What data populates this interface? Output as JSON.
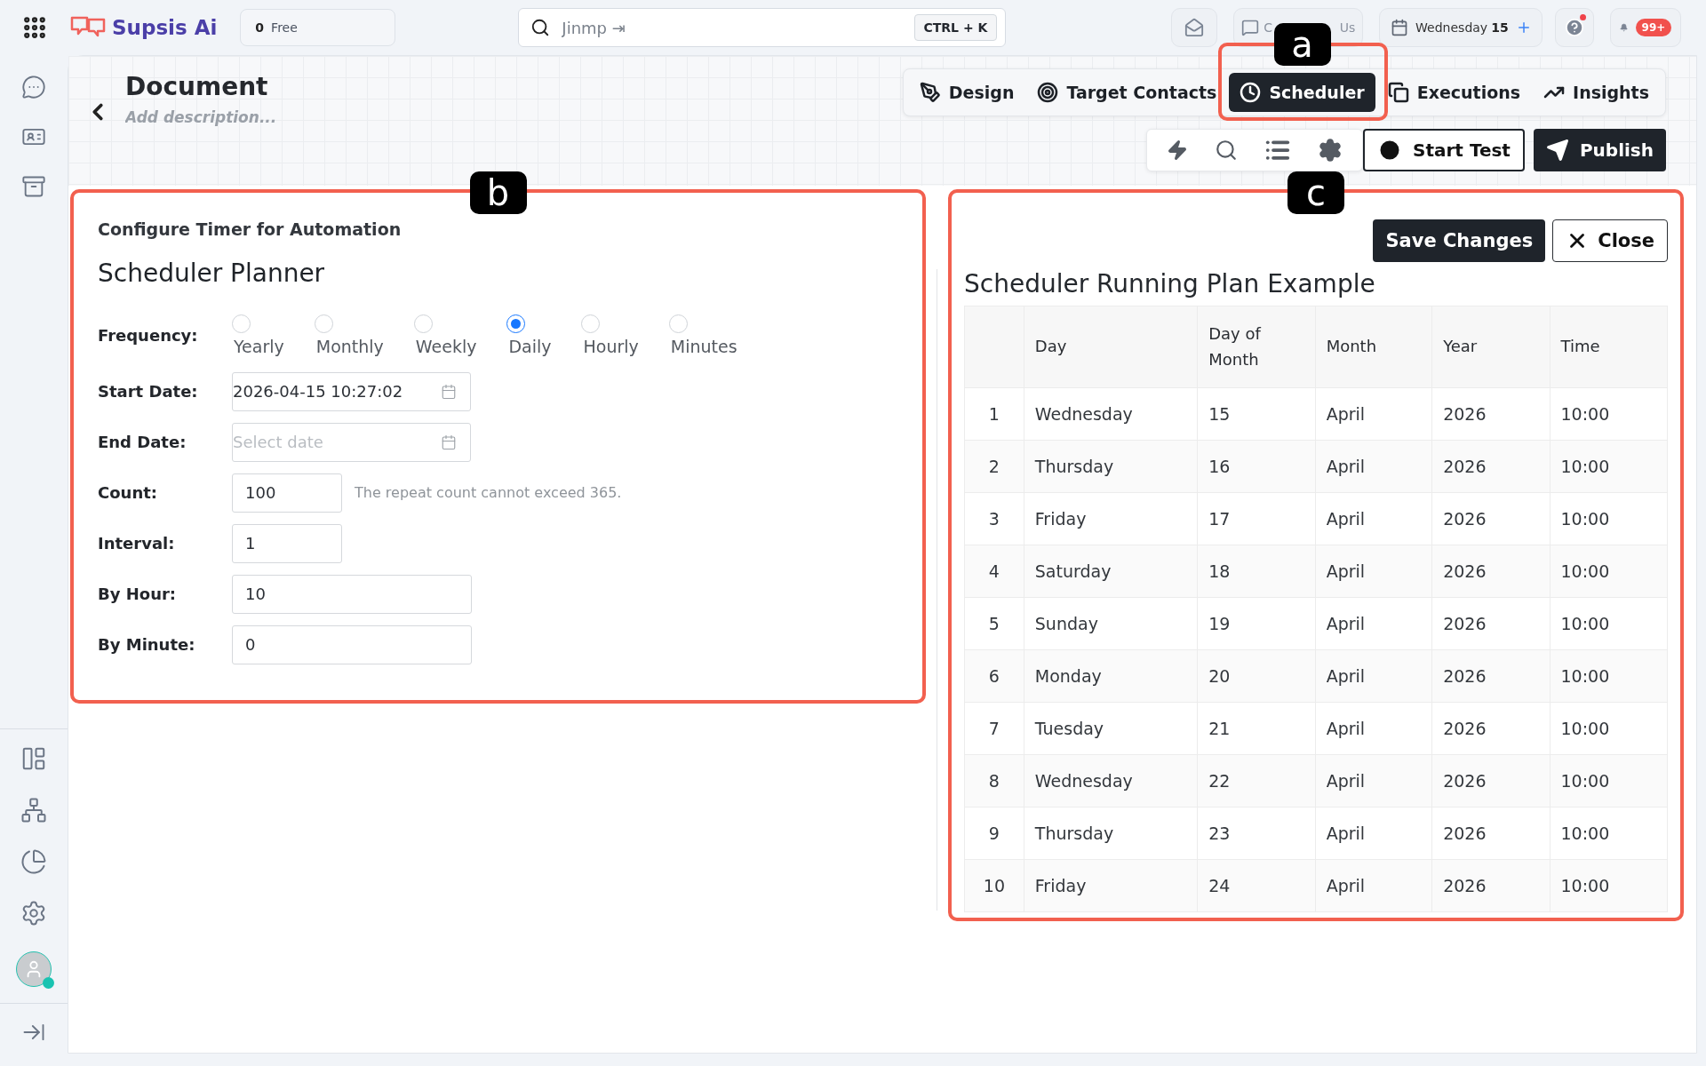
{
  "topbar": {
    "logo": "Supsis Ai",
    "credits": {
      "count": "0",
      "label": "Free"
    },
    "search": {
      "placeholder": "Jinmp ⇥",
      "shortcut": "CTRL + K"
    },
    "contact": {
      "start": "C",
      "end": "Us"
    },
    "date": {
      "day": "Wednesday",
      "number": "15"
    },
    "help_alert": true,
    "notifications": "99+"
  },
  "header": {
    "title": "Document",
    "description_placeholder": "Add description...",
    "tabs_annotation": "a"
  },
  "tabs": [
    {
      "kind": "design",
      "label": "Design",
      "selected": false
    },
    {
      "kind": "target",
      "label": "Target Contacts",
      "selected": false
    },
    {
      "kind": "scheduler",
      "label": "Scheduler",
      "selected": true
    },
    {
      "kind": "executions",
      "label": "Executions",
      "selected": false
    },
    {
      "kind": "insights",
      "label": "Insights",
      "selected": false
    }
  ],
  "toolbar": {
    "start_test": "Start Test",
    "publish": "Publish"
  },
  "config": {
    "annotation": "b",
    "subtitle": "Configure Timer for Automation",
    "title": "Scheduler Planner",
    "frequency": {
      "label": "Frequency:",
      "options": [
        {
          "label": "Yearly",
          "selected": false
        },
        {
          "label": "Monthly",
          "selected": false
        },
        {
          "label": "Weekly",
          "selected": false
        },
        {
          "label": "Daily",
          "selected": true
        },
        {
          "label": "Hourly",
          "selected": false
        },
        {
          "label": "Minutes",
          "selected": false
        }
      ]
    },
    "fields": [
      {
        "label": "Start Date:",
        "kind": "date",
        "value": "2026-04-15 10:27:02"
      },
      {
        "label": "End Date:",
        "kind": "date",
        "placeholder": "Select date"
      },
      {
        "label": "Count:",
        "kind": "short",
        "value": "100",
        "hint": "The repeat count cannot exceed 365."
      },
      {
        "label": "Interval:",
        "kind": "short",
        "value": "1"
      },
      {
        "label": "By Hour:",
        "kind": "wide",
        "value": "10"
      },
      {
        "label": "By Minute:",
        "kind": "wide",
        "value": "0"
      }
    ]
  },
  "plan": {
    "annotation": "c",
    "save": "Save Changes",
    "close": "Close",
    "title": "Scheduler Running Plan Example",
    "columns": [
      "",
      "Day",
      "Day of Month",
      "Month",
      "Year",
      "Time"
    ],
    "rows": [
      [
        "1",
        "Wednesday",
        "15",
        "April",
        "2026",
        "10:00"
      ],
      [
        "2",
        "Thursday",
        "16",
        "April",
        "2026",
        "10:00"
      ],
      [
        "3",
        "Friday",
        "17",
        "April",
        "2026",
        "10:00"
      ],
      [
        "4",
        "Saturday",
        "18",
        "April",
        "2026",
        "10:00"
      ],
      [
        "5",
        "Sunday",
        "19",
        "April",
        "2026",
        "10:00"
      ],
      [
        "6",
        "Monday",
        "20",
        "April",
        "2026",
        "10:00"
      ],
      [
        "7",
        "Tuesday",
        "21",
        "April",
        "2026",
        "10:00"
      ],
      [
        "8",
        "Wednesday",
        "22",
        "April",
        "2026",
        "10:00"
      ],
      [
        "9",
        "Thursday",
        "23",
        "April",
        "2026",
        "10:00"
      ],
      [
        "10",
        "Friday",
        "24",
        "April",
        "2026",
        "10:00"
      ]
    ]
  }
}
